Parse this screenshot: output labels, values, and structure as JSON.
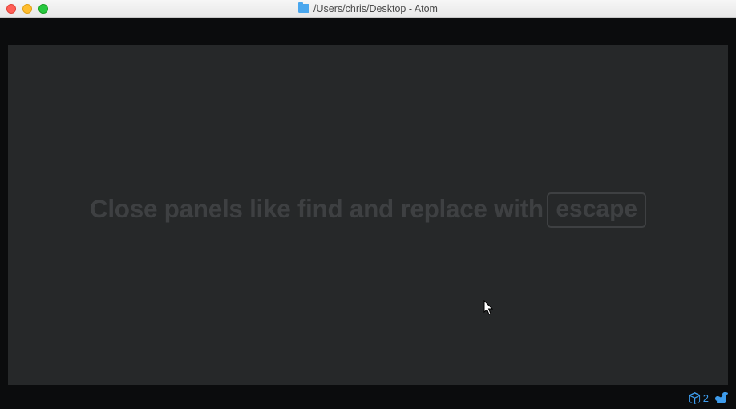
{
  "window": {
    "title": "/Users/chris/Desktop - Atom"
  },
  "tip": {
    "text": "Close panels like find and replace with",
    "key_label": "escape"
  },
  "status": {
    "git_count": "2"
  }
}
